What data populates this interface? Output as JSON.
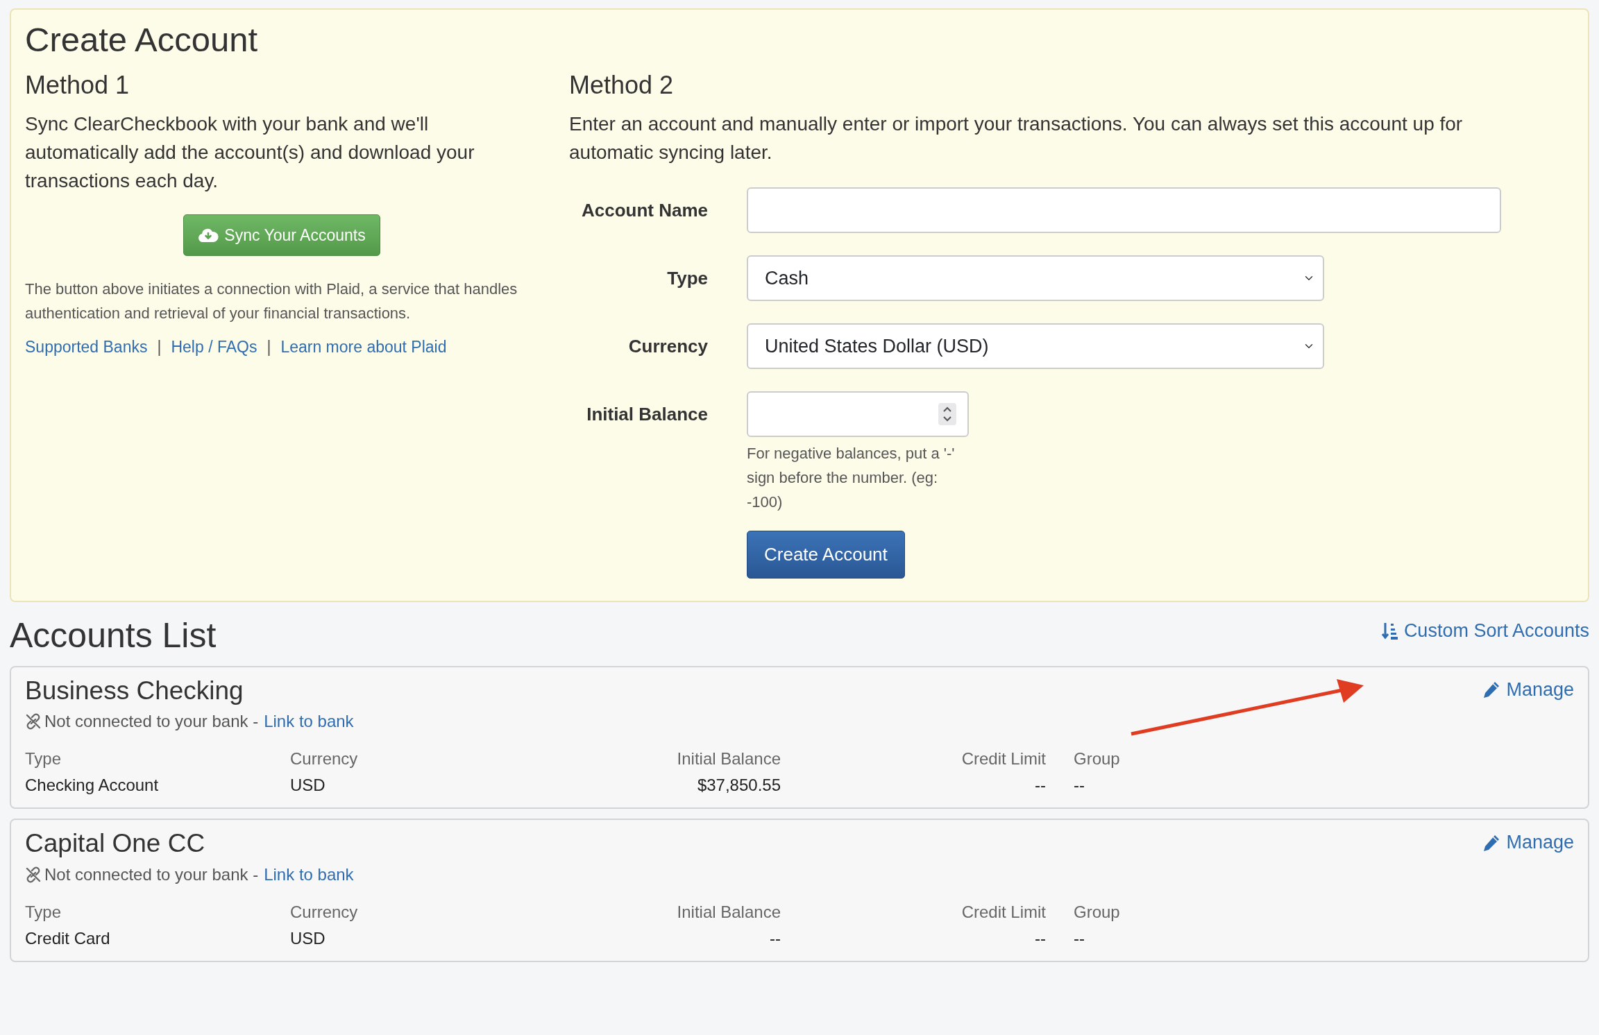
{
  "create_account": {
    "title": "Create Account",
    "method1": {
      "heading": "Method 1",
      "description": "Sync ClearCheckbook with your bank and we'll automatically add the account(s) and download your transactions each day.",
      "sync_button": "Sync Your Accounts",
      "note": "The button above initiates a connection with Plaid, a service that handles authentication and retrieval of your financial transactions.",
      "links": [
        {
          "kind": "link",
          "text": "Supported Banks"
        },
        {
          "kind": "separator",
          "text": "|"
        },
        {
          "kind": "link",
          "text": "Help / FAQs"
        },
        {
          "kind": "separator",
          "text": "|"
        },
        {
          "kind": "link",
          "text": "Learn more about Plaid"
        }
      ]
    },
    "method2": {
      "heading": "Method 2",
      "description": "Enter an account and manually enter or import your transactions. You can always set this account up for automatic syncing later.",
      "fields": [
        {
          "kind": "text",
          "label": "Account Name"
        },
        {
          "kind": "select",
          "label": "Type",
          "value": "Cash"
        },
        {
          "kind": "select",
          "label": "Currency",
          "value": "United States Dollar (USD)"
        },
        {
          "kind": "number",
          "label": "Initial Balance",
          "help": "For negative balances, put a '-' sign before the number. (eg: -100)"
        }
      ],
      "submit_button": "Create Account"
    }
  },
  "accounts_list": {
    "title": "Accounts List",
    "sort_link": "Custom Sort Accounts",
    "accounts": [
      {
        "name": "Business Checking",
        "status": "Not connected to your bank -",
        "link": "Link to bank",
        "manage": "Manage",
        "columns": [
          {
            "kind": "text",
            "label": "Type",
            "value": "Checking Account"
          },
          {
            "kind": "text",
            "label": "Currency",
            "value": "USD"
          },
          {
            "kind": "amount",
            "label": "Initial Balance",
            "value": "$37,850.55"
          },
          {
            "kind": "amount",
            "label": "Credit Limit",
            "value": "--"
          },
          {
            "kind": "text",
            "label": "Group",
            "value": "--"
          }
        ]
      },
      {
        "name": "Capital One CC",
        "status": "Not connected to your bank -",
        "link": "Link to bank",
        "manage": "Manage",
        "columns": [
          {
            "kind": "text",
            "label": "Type",
            "value": "Credit Card"
          },
          {
            "kind": "text",
            "label": "Currency",
            "value": "USD"
          },
          {
            "kind": "amount",
            "label": "Initial Balance",
            "value": "--"
          },
          {
            "kind": "amount",
            "label": "Credit Limit",
            "value": "--"
          },
          {
            "kind": "text",
            "label": "Group",
            "value": "--"
          }
        ]
      }
    ]
  }
}
